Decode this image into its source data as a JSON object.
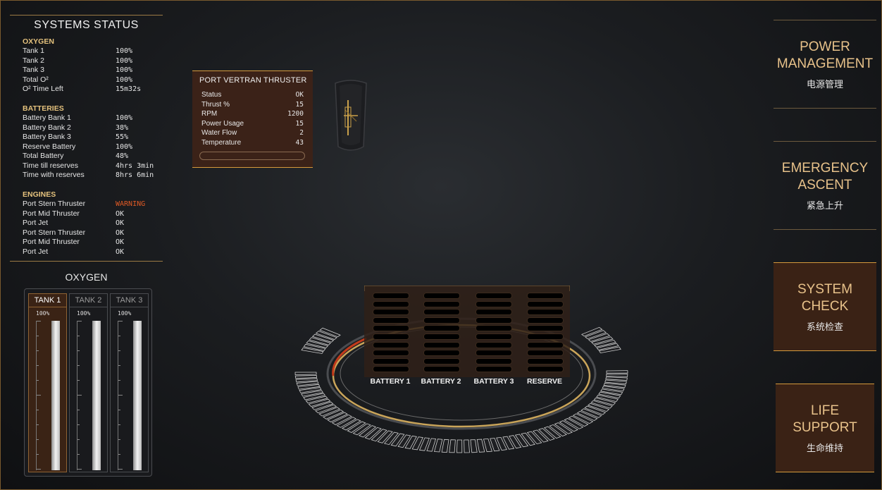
{
  "systems_status": {
    "title": "SYSTEMS STATUS",
    "oxygen": {
      "heading": "OXYGEN",
      "rows": [
        {
          "label": "Tank 1",
          "value": "100%"
        },
        {
          "label": "Tank 2",
          "value": "100%"
        },
        {
          "label": "Tank 3",
          "value": "100%"
        },
        {
          "label": "Total O²",
          "value": "100%"
        },
        {
          "label": "O² Time Left",
          "value": "15m32s"
        }
      ]
    },
    "batteries": {
      "heading": "BATTERIES",
      "rows": [
        {
          "label": "Battery Bank 1",
          "value": "100%"
        },
        {
          "label": "Battery Bank 2",
          "value": "38%"
        },
        {
          "label": "Battery Bank 3",
          "value": "55%"
        },
        {
          "label": "Reserve Battery",
          "value": "100%"
        },
        {
          "label": "Total Battery",
          "value": "48%"
        },
        {
          "label": "Time till reserves",
          "value": "4hrs 3min"
        },
        {
          "label": "Time with reserves",
          "value": "8hrs 6min"
        }
      ]
    },
    "engines": {
      "heading": "ENGINES",
      "rows": [
        {
          "label": "Port Stern Thruster",
          "value": "WARNING",
          "status": "warning"
        },
        {
          "label": "Port Mid Thruster",
          "value": "OK"
        },
        {
          "label": "Port Jet",
          "value": "OK"
        },
        {
          "label": "Port Stern Thruster",
          "value": "OK"
        },
        {
          "label": "Port Mid Thruster",
          "value": "OK"
        },
        {
          "label": "Port Jet",
          "value": "OK"
        }
      ]
    }
  },
  "oxygen_panel": {
    "title": "OXYGEN",
    "tanks": [
      {
        "label": "TANK 1",
        "percent": "100%",
        "level": 1.0,
        "active": true
      },
      {
        "label": "TANK 2",
        "percent": "100%",
        "level": 1.0,
        "active": false
      },
      {
        "label": "TANK 3",
        "percent": "100%",
        "level": 1.0,
        "active": false
      }
    ]
  },
  "thruster_popup": {
    "title": "PORT VERTRAN THRUSTER",
    "rows": [
      {
        "label": "Status",
        "value": "OK"
      },
      {
        "label": "Thrust %",
        "value": "15"
      },
      {
        "label": "RPM",
        "value": "1200"
      },
      {
        "label": "Power Usage",
        "value": "15"
      },
      {
        "label": "Water Flow",
        "value": "2"
      },
      {
        "label": "Temperature",
        "value": "43"
      }
    ]
  },
  "menu": {
    "power": {
      "line1": "POWER",
      "line2": "MANAGEMENT",
      "cn": "电源管理"
    },
    "emergency": {
      "line1": "EMERGENCY",
      "line2": "ASCENT",
      "cn": "紧急上升"
    },
    "system": {
      "line1": "SYSTEM",
      "line2": "CHECK",
      "cn": "系统检查"
    },
    "life": {
      "line1": "LIFE",
      "line2": "SUPPORT",
      "cn": "生命维持"
    }
  },
  "batteries_display": {
    "labels": [
      "BATTERY 1",
      "BATTERY 2",
      "BATTERY 3",
      "RESERVE"
    ]
  },
  "colors": {
    "accent": "#d59a3c",
    "warning": "#e05a25",
    "panel_fill": "#3a2215",
    "heading": "#e5c27d"
  }
}
